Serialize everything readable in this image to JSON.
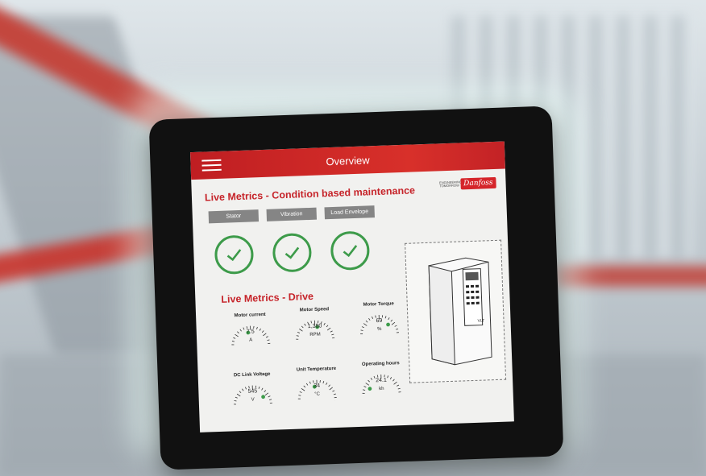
{
  "app": {
    "header_title": "Overview",
    "brand_small": "ENGINEERING TOMORROW",
    "brand_logo": "Danfoss"
  },
  "sections": {
    "condition_title": "Live Metrics - Condition based maintenance",
    "drive_title": "Live Metrics - Drive"
  },
  "condition_tabs": [
    "Stator",
    "Vibration",
    "Load Envelope"
  ],
  "condition_status": [
    "ok",
    "ok",
    "ok"
  ],
  "gauges": [
    {
      "title": "Motor current",
      "value": "7.5",
      "unit": "A",
      "level": 0.45
    },
    {
      "title": "Motor Speed",
      "value": "1,380",
      "unit": "RPM",
      "level": 0.55
    },
    {
      "title": "Motor Torque",
      "value": "69",
      "unit": "%",
      "level": 0.7
    },
    {
      "title": "DC Link Voltage",
      "value": "545",
      "unit": "V",
      "level": 0.75
    },
    {
      "title": "Unit Temperature",
      "value": "34",
      "unit": "°C",
      "level": 0.45
    },
    {
      "title": "Operating hours",
      "value": "24.1",
      "unit": "kh",
      "level": 0.2
    }
  ],
  "colors": {
    "accent": "#c6242a",
    "ok_green": "#3d9b4a",
    "tab_grey": "#858585"
  },
  "icons": {
    "menu": "hamburger-menu-icon",
    "status": "checkmark-circle-icon",
    "device": "drive-illustration"
  }
}
